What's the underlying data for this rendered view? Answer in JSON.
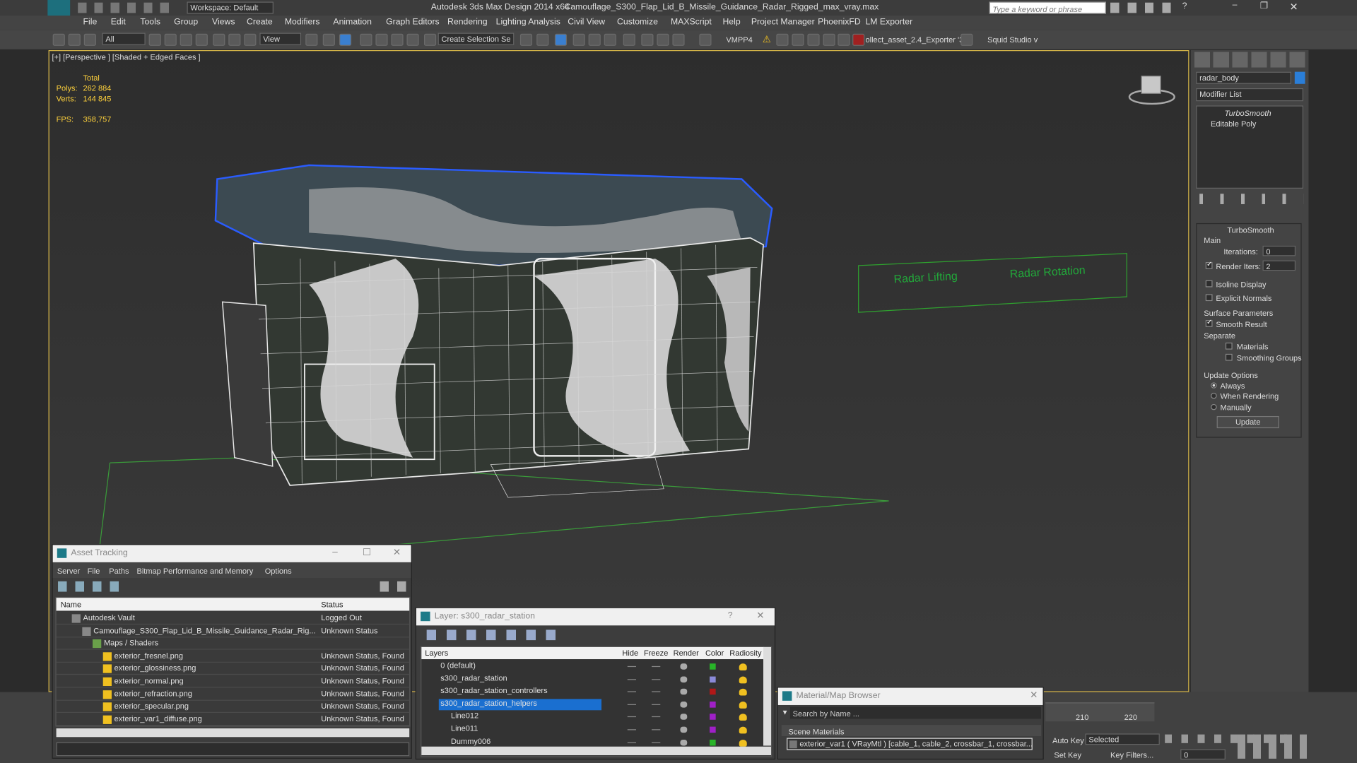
{
  "title_bar": {
    "workspace": "Workspace: Default",
    "title": "Autodesk 3ds Max Design 2014 x64",
    "file": "Camouflage_S300_Flap_Lid_B_Missile_Guidance_Radar_Rigged_max_vray.max",
    "search_placeholder": "Type a keyword or phrase"
  },
  "menu": [
    "File",
    "Edit",
    "Tools",
    "Group",
    "Views",
    "Create",
    "Modifiers",
    "Animation",
    "Graph Editors",
    "Rendering",
    "Lighting Analysis",
    "Civil View",
    "Customize",
    "MAXScript",
    "Help",
    "Project Manager",
    "PhoenixFD",
    "LM Exporter"
  ],
  "toolbar": {
    "filter": "All",
    "ref_coord": "View",
    "selection_set": "Create Selection Se",
    "vmpp": "VMPP4",
    "exporter": "ollect_asset_2.4_Exporter '3I",
    "squid": "Squid Studio v"
  },
  "viewport": {
    "label": "[+] [Perspective ] [Shaded + Edged Faces ]",
    "stats": {
      "total": "Total",
      "polys_label": "Polys:",
      "polys": "262 884",
      "verts_label": "Verts:",
      "verts": "144 845",
      "fps_label": "FPS:",
      "fps": "358,757"
    },
    "controls": [
      "Radar Lifting",
      "Radar Rotation"
    ]
  },
  "command_panel": {
    "object_name": "radar_body",
    "modifier_list": "Modifier List",
    "stack": [
      "TurboSmooth",
      "Editable Poly"
    ],
    "rollout": "TurboSmooth",
    "main": "Main",
    "iterations_label": "Iterations:",
    "iterations": "0",
    "render_iters_label": "Render Iters:",
    "render_iters": "2",
    "isoline": "Isoline Display",
    "explicit_normals": "Explicit Normals",
    "surface_params": "Surface Parameters",
    "smooth_result": "Smooth Result",
    "separate": "Separate",
    "materials": "Materials",
    "smoothing_groups": "Smoothing Groups",
    "update_options": "Update Options",
    "always": "Always",
    "when_rendering": "When Rendering",
    "manually": "Manually",
    "update": "Update"
  },
  "asset_tracking": {
    "title": "Asset Tracking",
    "menu": [
      "Server",
      "File",
      "Paths",
      "Bitmap Performance and Memory",
      "Options"
    ],
    "col_name": "Name",
    "col_status": "Status",
    "rows": [
      {
        "name": "Autodesk Vault",
        "status": "Logged Out",
        "indent": 0
      },
      {
        "name": "Camouflage_S300_Flap_Lid_B_Missile_Guidance_Radar_Rig...",
        "status": "Unknown Status",
        "indent": 1
      },
      {
        "name": "Maps / Shaders",
        "status": "",
        "indent": 2
      },
      {
        "name": "exterior_fresnel.png",
        "status": "Unknown Status, Found",
        "indent": 3
      },
      {
        "name": "exterior_glossiness.png",
        "status": "Unknown Status, Found",
        "indent": 3
      },
      {
        "name": "exterior_normal.png",
        "status": "Unknown Status, Found",
        "indent": 3
      },
      {
        "name": "exterior_refraction.png",
        "status": "Unknown Status, Found",
        "indent": 3
      },
      {
        "name": "exterior_specular.png",
        "status": "Unknown Status, Found",
        "indent": 3
      },
      {
        "name": "exterior_var1_diffuse.png",
        "status": "Unknown Status, Found",
        "indent": 3
      }
    ]
  },
  "layers": {
    "title": "Layer: s300_radar_station",
    "cols": [
      "Layers",
      "Hide",
      "Freeze",
      "Render",
      "Color",
      "Radiosity"
    ],
    "rows": [
      {
        "name": "0 (default)",
        "color": "#28b428",
        "sel": false,
        "indent": 0
      },
      {
        "name": "s300_radar_station",
        "color": "#8a8ad8",
        "sel": false,
        "indent": 0
      },
      {
        "name": "s300_radar_station_controllers",
        "color": "#b01818",
        "sel": false,
        "indent": 0
      },
      {
        "name": "s300_radar_station_helpers",
        "color": "#a020c8",
        "sel": true,
        "indent": 0
      },
      {
        "name": "Line012",
        "color": "#a020c8",
        "sel": false,
        "indent": 1
      },
      {
        "name": "Line011",
        "color": "#a020c8",
        "sel": false,
        "indent": 1
      },
      {
        "name": "Dummy006",
        "color": "#28b428",
        "sel": false,
        "indent": 1
      }
    ]
  },
  "material_browser": {
    "title": "Material/Map Browser",
    "search": "Search by Name ...",
    "section": "Scene Materials",
    "item": "exterior_var1  ( VRayMtl ) [cable_1, cable_2, crossbar_1, crossbar..."
  },
  "timeline": {
    "ticks": [
      "210",
      "220"
    ],
    "auto_key": "Auto Key",
    "set_key": "Set Key",
    "selected": "Selected",
    "key_filters": "Key Filters...",
    "frame": "0"
  }
}
